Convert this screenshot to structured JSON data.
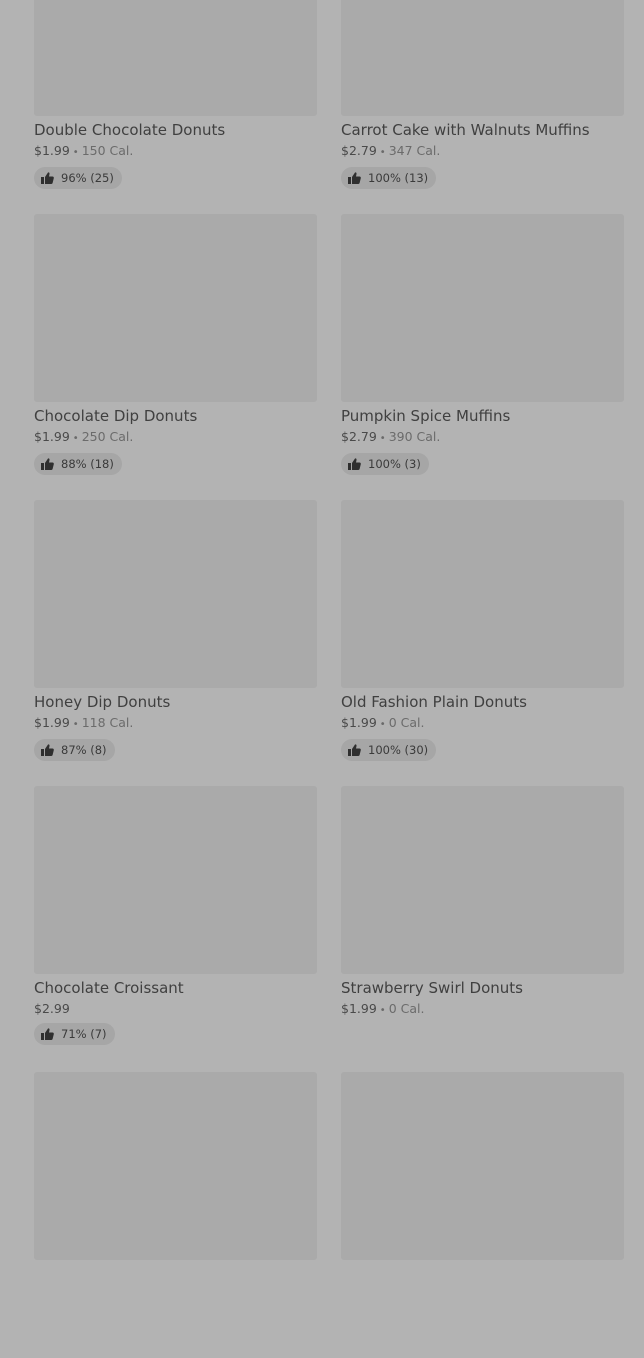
{
  "items": [
    {
      "name": "Double Chocolate Donuts",
      "price": "$1.99",
      "calories": "150 Cal.",
      "rating": "96% (25)"
    },
    {
      "name": "Carrot Cake with Walnuts Muffins",
      "price": "$2.79",
      "calories": "347 Cal.",
      "rating": "100% (13)"
    },
    {
      "name": "Chocolate Dip Donuts",
      "price": "$1.99",
      "calories": "250 Cal.",
      "rating": "88% (18)"
    },
    {
      "name": "Pumpkin Spice Muffins",
      "price": "$2.79",
      "calories": "390 Cal.",
      "rating": "100% (3)"
    },
    {
      "name": "Honey Dip Donuts",
      "price": "$1.99",
      "calories": "118 Cal.",
      "rating": "87% (8)"
    },
    {
      "name": "Old Fashion Plain Donuts",
      "price": "$1.99",
      "calories": "0 Cal.",
      "rating": "100% (30)"
    },
    {
      "name": "Chocolate Croissant",
      "price": "$2.99",
      "calories": "",
      "rating": "71% (7)"
    },
    {
      "name": "Strawberry Swirl Donuts",
      "price": "$1.99",
      "calories": "0 Cal.",
      "rating": ""
    }
  ],
  "separator": "•",
  "icons": {
    "rating": "thumbs-up-icon"
  },
  "colors": {
    "background": "#b3b3b3",
    "placeholder": "#aaaaaa",
    "pill": "#a6a6a6"
  }
}
